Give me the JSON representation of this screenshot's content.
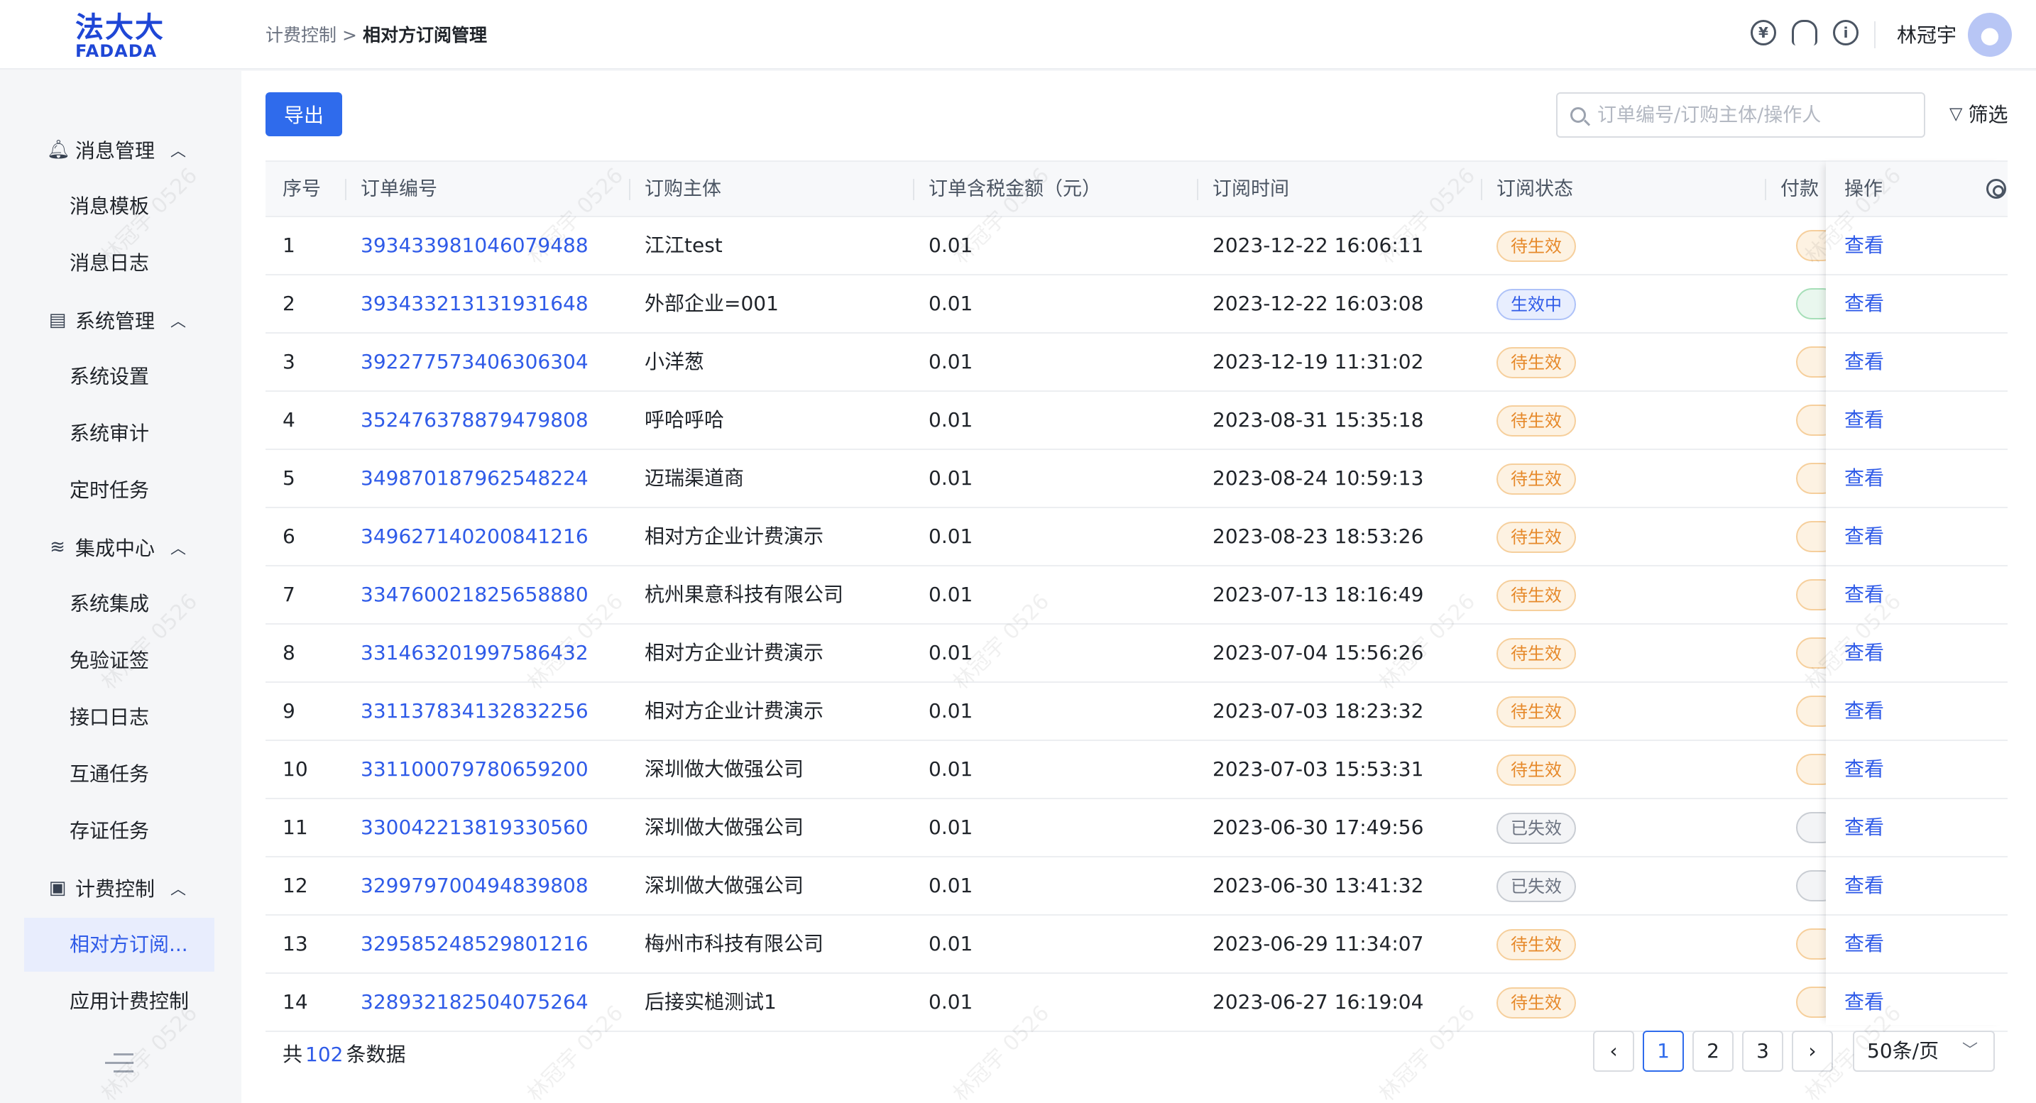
{
  "header": {
    "logo_cn": "法大大",
    "logo_en": "FADADA",
    "breadcrumb": {
      "parent": "计费控制",
      "separator": ">",
      "current": "相对方订阅管理"
    },
    "icons": [
      "yuan-icon",
      "headset-icon",
      "info-icon"
    ],
    "username": "林冠宇"
  },
  "sidebar": {
    "groups": [
      {
        "label": "消息管理",
        "icon": "bell-icon",
        "items": [
          "消息模板",
          "消息日志"
        ]
      },
      {
        "label": "系统管理",
        "icon": "layout-icon",
        "items": [
          "系统设置",
          "系统审计",
          "定时任务"
        ]
      },
      {
        "label": "集成中心",
        "icon": "layers-icon",
        "items": [
          "系统集成",
          "免验证签",
          "接口日志",
          "互通任务",
          "存证任务"
        ]
      },
      {
        "label": "计费控制",
        "icon": "billing-icon",
        "items": [
          "相对方订阅...",
          "应用计费控制"
        ]
      }
    ],
    "active_item": "相对方订阅..."
  },
  "toolbar": {
    "export_label": "导出",
    "search_placeholder": "订单编号/订购主体/操作人",
    "filter_label": "筛选"
  },
  "table": {
    "columns": [
      "序号",
      "订单编号",
      "订购主体",
      "订单含税金额（元）",
      "订阅时间",
      "订阅状态",
      "付款",
      "操作"
    ],
    "rows": [
      {
        "no": "1",
        "order_id": "393433981046079488",
        "subject": "江江test",
        "amount": "0.01",
        "time": "2023-12-22 16:06:11",
        "status": "待生效",
        "status_type": "pending",
        "pay_type": "orange",
        "action": "查看"
      },
      {
        "no": "2",
        "order_id": "393433213131931648",
        "subject": "外部企业=001",
        "amount": "0.01",
        "time": "2023-12-22 16:03:08",
        "status": "生效中",
        "status_type": "active",
        "pay_type": "green",
        "action": "查看"
      },
      {
        "no": "3",
        "order_id": "392277573406306304",
        "subject": "小洋葱",
        "amount": "0.01",
        "time": "2023-12-19 11:31:02",
        "status": "待生效",
        "status_type": "pending",
        "pay_type": "orange",
        "action": "查看"
      },
      {
        "no": "4",
        "order_id": "352476378879479808",
        "subject": "呼哈呼哈",
        "amount": "0.01",
        "time": "2023-08-31 15:35:18",
        "status": "待生效",
        "status_type": "pending",
        "pay_type": "orange",
        "action": "查看"
      },
      {
        "no": "5",
        "order_id": "349870187962548224",
        "subject": "迈瑞渠道商",
        "amount": "0.01",
        "time": "2023-08-24 10:59:13",
        "status": "待生效",
        "status_type": "pending",
        "pay_type": "orange",
        "action": "查看"
      },
      {
        "no": "6",
        "order_id": "349627140200841216",
        "subject": "相对方企业计费演示",
        "amount": "0.01",
        "time": "2023-08-23 18:53:26",
        "status": "待生效",
        "status_type": "pending",
        "pay_type": "orange",
        "action": "查看"
      },
      {
        "no": "7",
        "order_id": "334760021825658880",
        "subject": "杭州果意科技有限公司",
        "amount": "0.01",
        "time": "2023-07-13 18:16:49",
        "status": "待生效",
        "status_type": "pending",
        "pay_type": "orange",
        "action": "查看"
      },
      {
        "no": "8",
        "order_id": "331463201997586432",
        "subject": "相对方企业计费演示",
        "amount": "0.01",
        "time": "2023-07-04 15:56:26",
        "status": "待生效",
        "status_type": "pending",
        "pay_type": "orange",
        "action": "查看"
      },
      {
        "no": "9",
        "order_id": "331137834132832256",
        "subject": "相对方企业计费演示",
        "amount": "0.01",
        "time": "2023-07-03 18:23:32",
        "status": "待生效",
        "status_type": "pending",
        "pay_type": "orange",
        "action": "查看"
      },
      {
        "no": "10",
        "order_id": "331100079780659200",
        "subject": "深圳做大做强公司",
        "amount": "0.01",
        "time": "2023-07-03 15:53:31",
        "status": "待生效",
        "status_type": "pending",
        "pay_type": "orange",
        "action": "查看"
      },
      {
        "no": "11",
        "order_id": "330042213819330560",
        "subject": "深圳做大做强公司",
        "amount": "0.01",
        "time": "2023-06-30 17:49:56",
        "status": "已失效",
        "status_type": "expired",
        "pay_type": "gray",
        "action": "查看"
      },
      {
        "no": "12",
        "order_id": "329979700494839808",
        "subject": "深圳做大做强公司",
        "amount": "0.01",
        "time": "2023-06-30 13:41:32",
        "status": "已失效",
        "status_type": "expired",
        "pay_type": "gray",
        "action": "查看"
      },
      {
        "no": "13",
        "order_id": "329585248529801216",
        "subject": "梅州市科技有限公司",
        "amount": "0.01",
        "time": "2023-06-29 11:34:07",
        "status": "待生效",
        "status_type": "pending",
        "pay_type": "orange",
        "action": "查看"
      },
      {
        "no": "14",
        "order_id": "328932182504075264",
        "subject": "后接实槌测试1",
        "amount": "0.01",
        "time": "2023-06-27 16:19:04",
        "status": "待生效",
        "status_type": "pending",
        "pay_type": "orange",
        "action": "查看"
      }
    ]
  },
  "footer": {
    "total_prefix": "共",
    "total_count": "102",
    "total_suffix": "条数据",
    "pages": [
      "1",
      "2",
      "3"
    ],
    "current_page": "1",
    "page_size": "50条/页"
  },
  "watermark": "林冠宇 0526",
  "colors": {
    "primary": "#2f6bec",
    "link": "#2f5be8",
    "pending": "#e6892a",
    "expired": "#6b7280"
  }
}
